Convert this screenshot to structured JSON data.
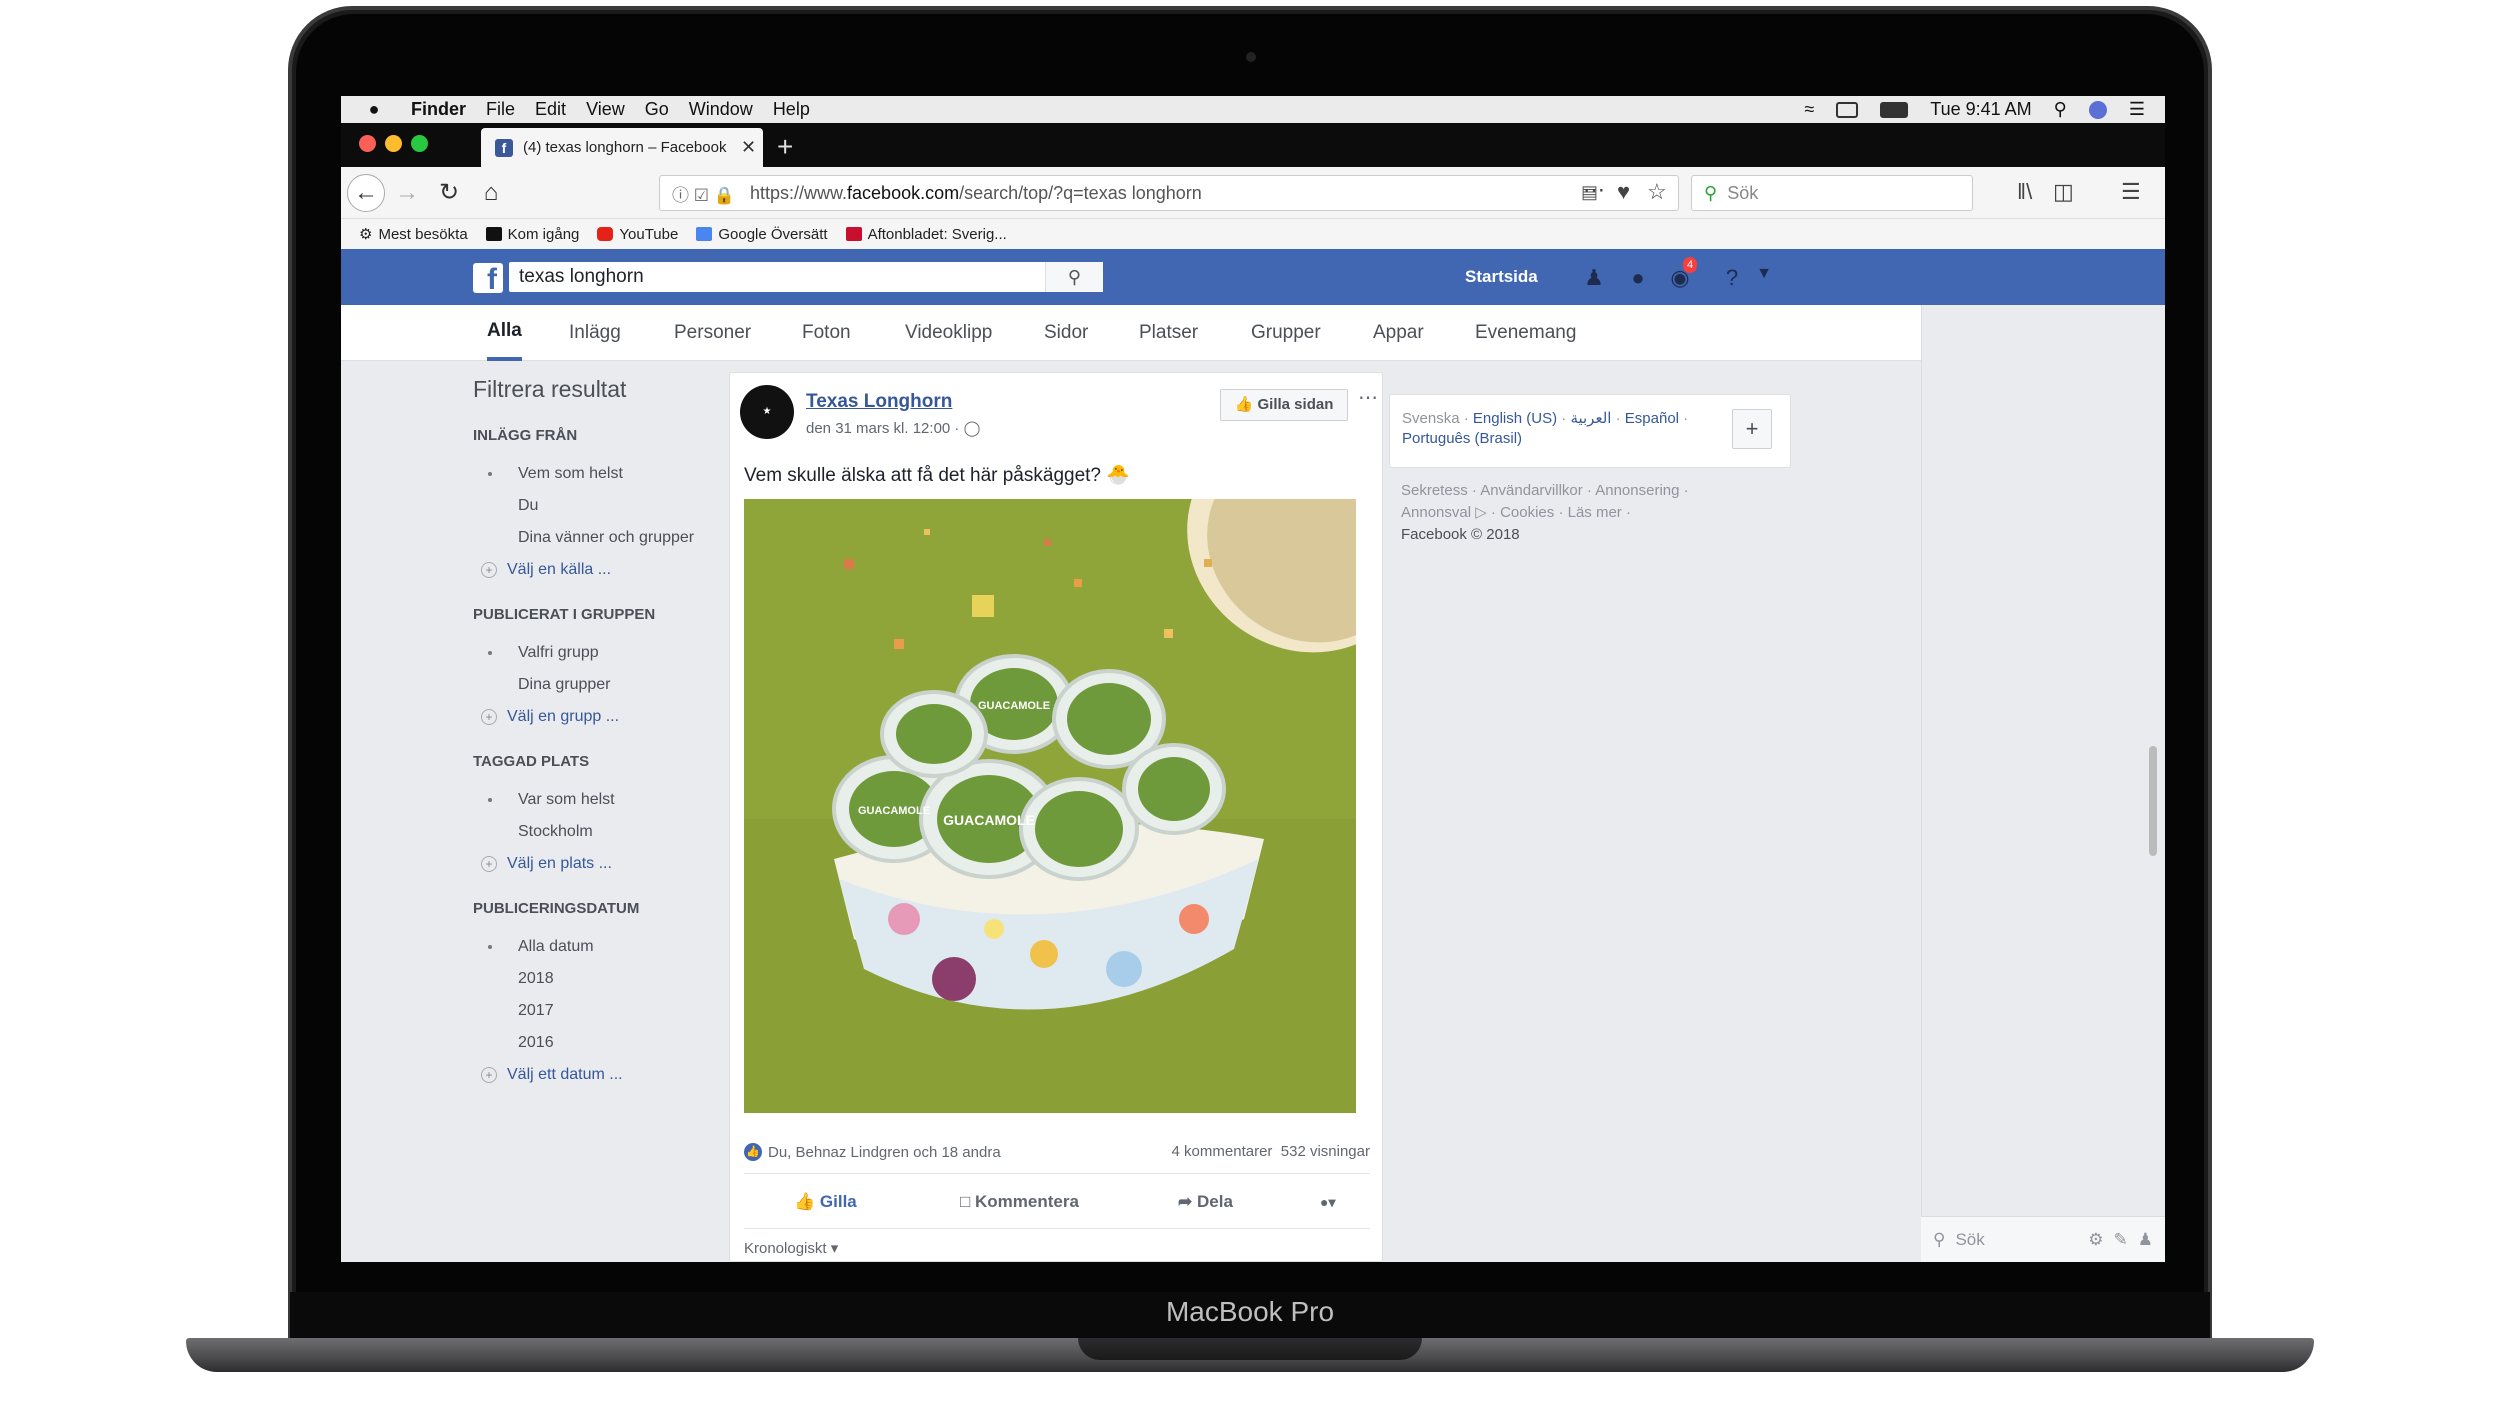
{
  "device": {
    "label": "MacBook Pro"
  },
  "menubar": {
    "app": "Finder",
    "items": [
      "File",
      "Edit",
      "View",
      "Go",
      "Window",
      "Help"
    ],
    "clock": "Tue 9:41 AM"
  },
  "browser": {
    "tab_title": "(4) texas longhorn – Facebook",
    "url_prefix": "https://www.",
    "url_domain": "facebook.com",
    "url_path": "/search/top/?q=texas longhorn",
    "search_placeholder": "Sök",
    "bookmarks": [
      "Mest besökta",
      "Kom igång",
      "YouTube",
      "Google Översätt",
      "Aftonbladet: Sverig..."
    ]
  },
  "facebook": {
    "search_value": "texas longhorn",
    "home_label": "Startsida",
    "notification_count": "4",
    "tabs": [
      "Alla",
      "Inlägg",
      "Personer",
      "Foton",
      "Videoklipp",
      "Sidor",
      "Platser",
      "Grupper",
      "Appar",
      "Evenemang"
    ],
    "filters": {
      "title": "Filtrera resultat",
      "sections": [
        {
          "heading": "INLÄGG FRÅN",
          "options": [
            "Vem som helst",
            "Du",
            "Dina vänner och grupper"
          ],
          "link": "Välj en källa ..."
        },
        {
          "heading": "PUBLICERAT I GRUPPEN",
          "options": [
            "Valfri grupp",
            "Dina grupper"
          ],
          "link": "Välj en grupp ..."
        },
        {
          "heading": "TAGGAD PLATS",
          "options": [
            "Var som helst",
            "Stockholm"
          ],
          "link": "Välj en plats ..."
        },
        {
          "heading": "PUBLICERINGSDATUM",
          "options": [
            "Alla datum",
            "2018",
            "2017",
            "2016"
          ],
          "link": "Välj ett datum ..."
        }
      ]
    },
    "post": {
      "author": "Texas Longhorn",
      "date": "den 31 mars kl. 12:00 ·",
      "like_page": "Gilla sidan",
      "text": "Vem skulle älska att få det här påskägget? 🐣",
      "image_labels": [
        "GUACAMOLE",
        "GUACAMOLE",
        "GUACAMOLE"
      ],
      "reactions": "Du, Behnaz Lindgren och 18 andra",
      "comments": "4 kommentarer",
      "views": "532 visningar",
      "actions": [
        "Gilla",
        "Kommentera",
        "Dela"
      ],
      "sort": "Kronologiskt"
    },
    "languages": {
      "current": "Svenska",
      "others": [
        "English (US)",
        "العربية",
        "Español",
        "Português (Brasil)"
      ]
    },
    "footer": {
      "line1": "Sekretess · Användarvillkor · Annonsering ·",
      "line2": "Annonsval ▷ · Cookies · Läs mer ·",
      "copyright": "Facebook © 2018"
    },
    "chat_search": "Sök"
  },
  "colors": {
    "facebook_blue": "#4267b2",
    "link": "#365899",
    "image_bg": "#8fa53a"
  }
}
